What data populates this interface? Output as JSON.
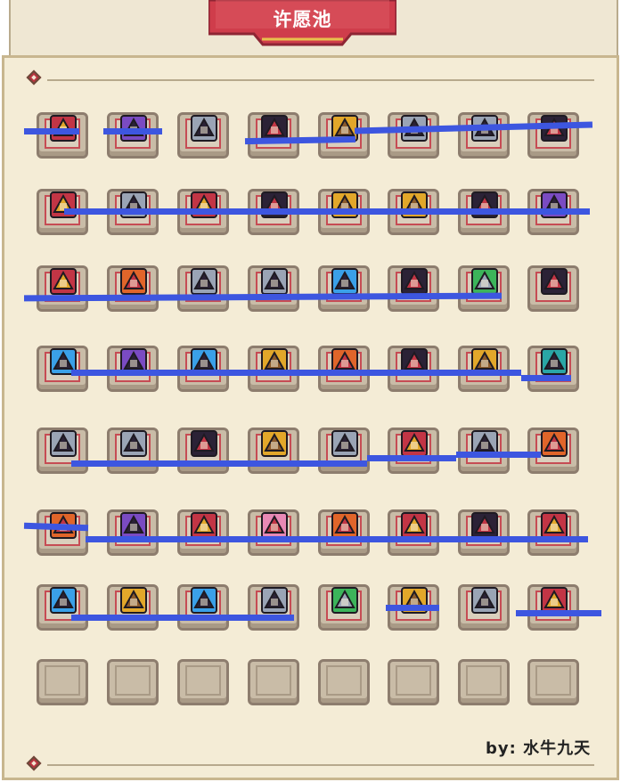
{
  "title": "许愿池",
  "byline": "by: 水牛九天",
  "colors": {
    "panel_bg": "#f4ecd6",
    "slot_frame_red": "#c64c54",
    "strike_blue": "#3d56e0"
  },
  "grid": {
    "rows": [
      [
        "crimson-sword-icon",
        "violet-blade-icon",
        "gear-staff-icon",
        "shadow-axe-icon",
        "golden-sickle-icon",
        "heavy-gun-icon",
        "spiked-crossbow-icon",
        "horned-shield-icon"
      ],
      [
        "demon-horn-armor-icon",
        "laser-rifle-icon",
        "golden-chest-armor-icon",
        "bronze-armor-icon",
        "golden-shoulder-armor-icon",
        "gold-orb-staff-icon",
        "dark-wing-blade-icon",
        "purple-halo-icon"
      ],
      [
        "red-gauntlet-icon",
        "flame-horn-armor-icon",
        "spear-tip-icon",
        "sniper-rifle-icon",
        "blue-helmet-icon",
        "owl-cloak-icon",
        "green-gem-device-icon",
        "horned-crown-icon"
      ],
      [
        "blue-diamond-icon",
        "purple-box-icon",
        "blue-device-icon",
        "golden-boots-icon",
        "orange-crystal-icon",
        "dual-blade-icon",
        "golden-key-staff-icon",
        "teal-bow-icon"
      ],
      [
        "stone-gauntlet-icon",
        "steel-hammer-icon",
        "rune-wheel-icon",
        "golden-trident-icon",
        "blue-crossbow-icon",
        "red-blade-icon",
        "stone-fist-icon",
        "fire-crescent-icon"
      ],
      [
        "flame-crescent-icon",
        "purple-fortress-icon",
        "red-ring-icon",
        "pink-necklace-icon",
        "flame-robe-icon",
        "tiger-mask-icon",
        "dark-knight-icon",
        "red-laser-sword-icon"
      ],
      [
        "ice-blade-icon",
        "chicken-leg-icon",
        "swordfish-icon",
        "water-gun-icon",
        "green-goggles-icon",
        "golden-shield-icon",
        "reaper-scythe-icon",
        "treasure-chest-icon"
      ],
      [
        "empty-slot",
        "empty-slot",
        "empty-slot",
        "empty-slot",
        "empty-slot",
        "empty-slot",
        "empty-slot",
        "empty-slot"
      ]
    ]
  }
}
